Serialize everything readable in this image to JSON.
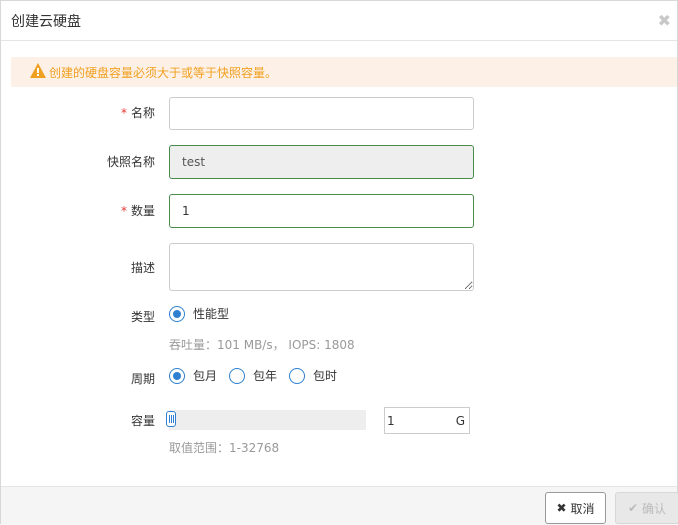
{
  "dialog": {
    "title": "创建云硬盘",
    "close_icon": "close-icon"
  },
  "alert": {
    "icon": "warning-icon",
    "text": "创建的硬盘容量必须大于或等于快照容量。",
    "color": "#f0a020"
  },
  "form": {
    "required_mark": "*",
    "name": {
      "label": "名称",
      "value": "",
      "placeholder": ""
    },
    "snapshot_name": {
      "label": "快照名称",
      "value": "test"
    },
    "quantity": {
      "label": "数量",
      "value": "1"
    },
    "description": {
      "label": "描述",
      "value": ""
    },
    "type": {
      "label": "类型",
      "options": [
        {
          "label": "性能型",
          "checked": true
        }
      ],
      "hint": "吞吐量：101 MB/s， IOPS: 1808"
    },
    "period": {
      "label": "周期",
      "options": [
        {
          "label": "包月",
          "checked": true
        },
        {
          "label": "包年",
          "checked": false
        },
        {
          "label": "包时",
          "checked": false
        }
      ]
    },
    "capacity": {
      "label": "容量",
      "value": "1",
      "unit": "G",
      "range_hint": "取值范围：1-32768",
      "min": 1,
      "max": 32768,
      "slider_fraction": 0.0
    }
  },
  "footer": {
    "cancel_label": "取消",
    "cancel_icon": "times-icon",
    "confirm_label": "确认",
    "confirm_icon": "check-icon"
  },
  "colors": {
    "accent": "#2f80d0",
    "required": "#e53935",
    "valid_border": "#4a8a4a"
  }
}
